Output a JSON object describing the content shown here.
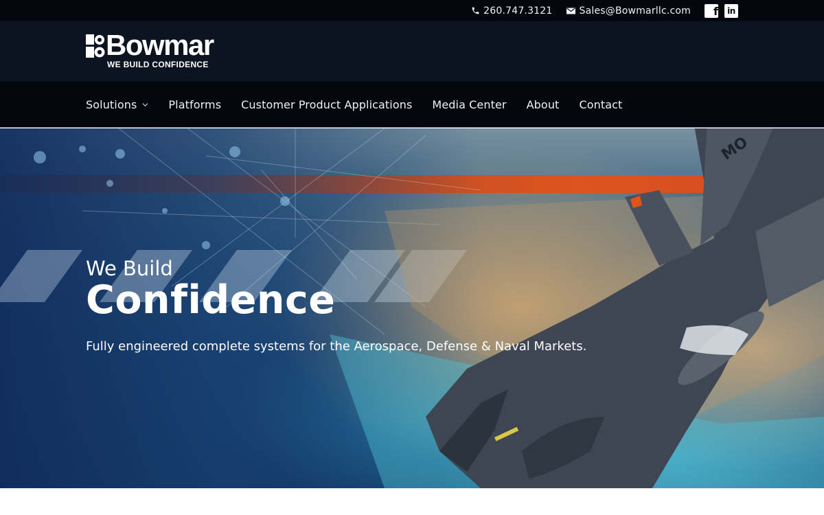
{
  "topbar": {
    "phone": "260.747.3121",
    "email": "Sales@Bowmarllc.com",
    "phone_icon": "phone-icon",
    "email_icon": "envelope-icon",
    "social": [
      {
        "name": "facebook",
        "glyph": "f"
      },
      {
        "name": "linkedin",
        "glyph": "in"
      }
    ]
  },
  "logo": {
    "wordmark": "Bowmar",
    "tagline": "WE BUILD CONFIDENCE"
  },
  "nav": {
    "items": [
      {
        "label": "Solutions",
        "has_dropdown": true
      },
      {
        "label": "Platforms"
      },
      {
        "label": "Customer Product Applications"
      },
      {
        "label": "Media Center"
      },
      {
        "label": "About"
      },
      {
        "label": "Contact"
      }
    ]
  },
  "hero": {
    "kicker": "We Build",
    "headline": "Confidence",
    "subhead": "Fully engineered complete systems for the Aerospace, Defense & Naval Markets.",
    "tail_code": "MO"
  },
  "colors": {
    "topbar_bg": "#04070d",
    "logo_band_bg": "#0c1422",
    "nav_bg": "#04070d",
    "accent_orange": "#e2521a",
    "hero_blue": "#1f4e7b"
  }
}
